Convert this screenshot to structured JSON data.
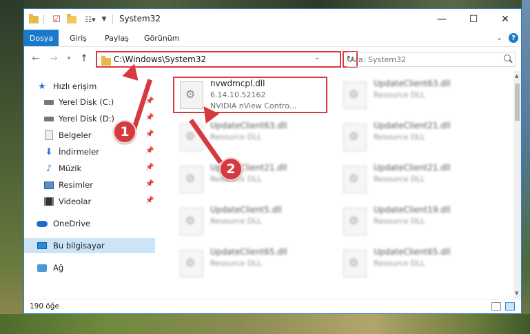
{
  "window": {
    "title": "System32"
  },
  "ribbon": {
    "tabs": [
      "Dosya",
      "Giriş",
      "Paylaş",
      "Görünüm"
    ],
    "help": "?"
  },
  "navigation": {
    "address": "C:\\Windows\\System32",
    "search_placeholder": "Ara: System32"
  },
  "sidebar": {
    "items": [
      {
        "label": "Hızlı erişim",
        "icon": "star-icon"
      },
      {
        "label": "Yerel Disk (C:)",
        "icon": "disk-icon"
      },
      {
        "label": "Yerel Disk (D:)",
        "icon": "disk-icon"
      },
      {
        "label": "Belgeler",
        "icon": "document-icon"
      },
      {
        "label": "İndirmeler",
        "icon": "download-icon"
      },
      {
        "label": "Müzik",
        "icon": "music-icon"
      },
      {
        "label": "Resimler",
        "icon": "picture-icon"
      },
      {
        "label": "Videolar",
        "icon": "video-icon"
      },
      {
        "label": "OneDrive",
        "icon": "cloud-icon"
      },
      {
        "label": "Bu bilgisayar",
        "icon": "computer-icon"
      },
      {
        "label": "Ağ",
        "icon": "network-icon"
      }
    ]
  },
  "files": [
    {
      "name": "nvwdmcpl.dll",
      "line2": "6.14.10.52162",
      "line3": "NVIDIA nView Contro..."
    },
    {
      "name": "UpdateClient63.dll",
      "line2": "Resource DLL"
    },
    {
      "name": "UpdateClient63.dll",
      "line2": "Resource DLL"
    },
    {
      "name": "UpdateClient21.dll",
      "line2": "Resource DLL"
    },
    {
      "name": "UpdateClient21.dll",
      "line2": "Resource DLL"
    },
    {
      "name": "UpdateClient21.dll",
      "line2": "Resource DLL"
    },
    {
      "name": "UpdateClient5.dll",
      "line2": "Resource DLL"
    },
    {
      "name": "UpdateClient19.dll",
      "line2": "Resource DLL"
    },
    {
      "name": "UpdateClient65.dll",
      "line2": "Resource DLL"
    },
    {
      "name": "UpdateClient65.dll",
      "line2": "Resource DLL"
    }
  ],
  "status": {
    "count": "190 öğe"
  },
  "callouts": [
    "1",
    "2"
  ],
  "colors": {
    "accent": "#1979ca",
    "highlight": "#d9373c",
    "selection": "#cce4f7"
  }
}
